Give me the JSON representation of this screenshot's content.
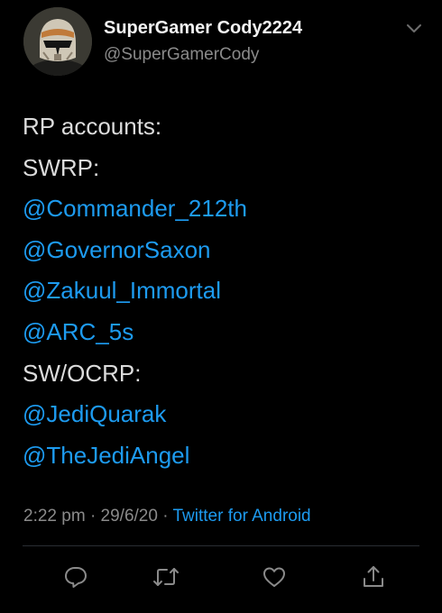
{
  "author": {
    "display_name": "SuperGamer Cody2224",
    "handle": "@SuperGamerCody",
    "avatar_icon": "clone-trooper-helmet-avatar"
  },
  "tweet": {
    "lines": [
      {
        "text": "RP accounts:",
        "kind": "plain"
      },
      {
        "text": "SWRP:",
        "kind": "plain"
      },
      {
        "text": "@Commander_212th",
        "kind": "mention"
      },
      {
        "text": "@GovernorSaxon",
        "kind": "mention"
      },
      {
        "text": "@Zakuul_Immortal",
        "kind": "mention"
      },
      {
        "text": "@ARC_5s",
        "kind": "mention"
      },
      {
        "text": "SW/OCRP:",
        "kind": "plain"
      },
      {
        "text": "@JediQuarak",
        "kind": "mention"
      },
      {
        "text": "@TheJediAngel",
        "kind": "mention"
      }
    ],
    "time": "2:22 pm",
    "date": "29/6/20",
    "separator": "·",
    "source": "Twitter for Android"
  },
  "actions": [
    {
      "name": "reply",
      "icon": "reply-bubble-icon"
    },
    {
      "name": "retweet",
      "icon": "retweet-icon"
    },
    {
      "name": "like",
      "icon": "heart-icon"
    },
    {
      "name": "share",
      "icon": "share-icon"
    }
  ],
  "colors": {
    "background": "#000000",
    "text": "#dcdcdc",
    "secondary": "#8a8a8a",
    "link": "#1d9bf0",
    "divider": "#2a2e33"
  }
}
